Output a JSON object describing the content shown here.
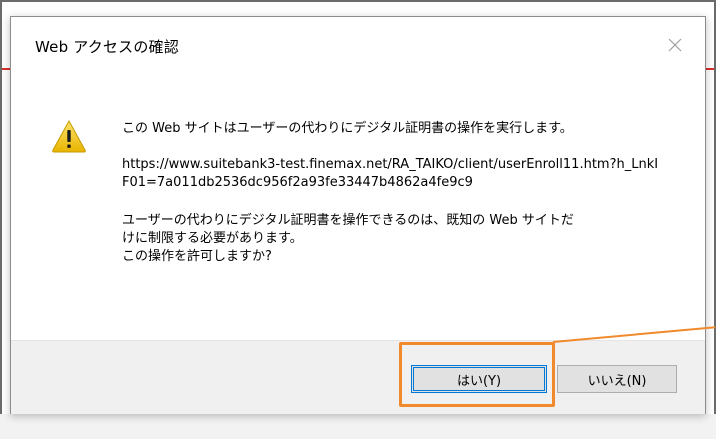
{
  "dialog": {
    "title": "Web アクセスの確認",
    "message_intro": "この Web サイトはユーザーの代わりにデジタル証明書の操作を実行します。",
    "url": "https://www.suitebank3-test.finemax.net/RA_TAIKO/client/userEnroll11.htm?h_LnkIF01=7a011db2536dc956f2a93fe33447b4862a4fe9c9",
    "warning_line1": "ユーザーの代わりにデジタル証明書を操作できるのは、既知の Web サイトだ",
    "warning_line2": "けに制限する必要があります。",
    "warning_line3": "この操作を許可しますか?",
    "yes_label": "はい(Y)",
    "no_label": "いいえ(N)"
  },
  "icons": {
    "warning": "warning-icon",
    "close": "close-icon"
  },
  "colors": {
    "highlight": "#f08a2c",
    "accent": "#0078d7",
    "warning_yellow": "#f5c518",
    "background_accent": "#d9302c"
  }
}
